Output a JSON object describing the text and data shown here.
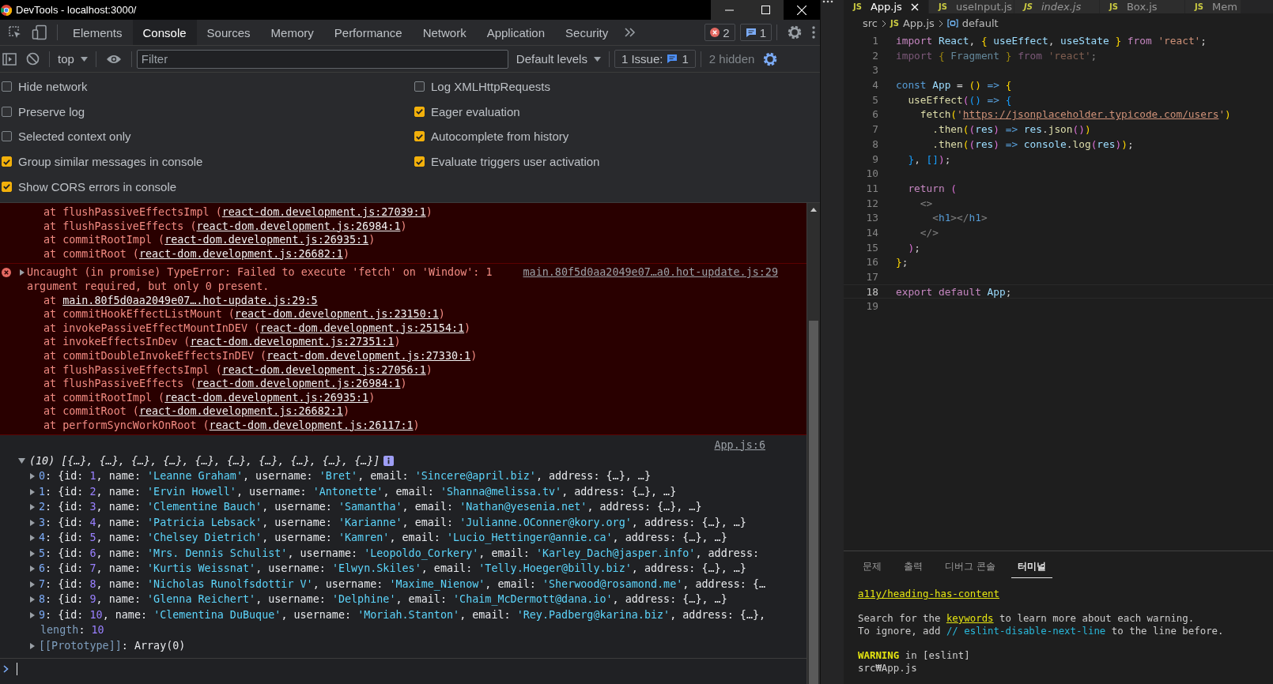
{
  "window": {
    "title": "DevTools - localhost:3000/"
  },
  "tabs": [
    {
      "label": "Elements",
      "selected": false
    },
    {
      "label": "Console",
      "selected": true
    },
    {
      "label": "Sources",
      "selected": false
    },
    {
      "label": "Memory",
      "selected": false
    },
    {
      "label": "Performance",
      "selected": false
    },
    {
      "label": "Network",
      "selected": false
    },
    {
      "label": "Application",
      "selected": false
    },
    {
      "label": "Security",
      "selected": false
    }
  ],
  "badges": {
    "errors": "2",
    "messages": "1"
  },
  "toolbar": {
    "context": "top",
    "filter_placeholder": "Filter",
    "levels": "Default levels",
    "issues_label": "1 Issue:",
    "issues_count": "1",
    "hidden": "2 hidden"
  },
  "settings": [
    {
      "label": "Hide network",
      "checked": false
    },
    {
      "label": "Preserve log",
      "checked": false
    },
    {
      "label": "Selected context only",
      "checked": false
    },
    {
      "label": "Group similar messages in console",
      "checked": true
    },
    {
      "label": "Show CORS errors in console",
      "checked": true
    },
    {
      "label": "Log XMLHttpRequests",
      "checked": false
    },
    {
      "label": "Eager evaluation",
      "checked": true
    },
    {
      "label": "Autocomplete from history",
      "checked": true
    },
    {
      "label": "Evaluate triggers user activation",
      "checked": true
    }
  ],
  "messages": [
    {
      "kind": "error",
      "frames": [
        {
          "fn": "at flushPassiveEffectsImpl (",
          "link": "react-dom.development.js:27039:1",
          "after": ")"
        },
        {
          "fn": "at flushPassiveEffects (",
          "link": "react-dom.development.js:26984:1",
          "after": ")"
        },
        {
          "fn": "at commitRootImpl (",
          "link": "react-dom.development.js:26935:1",
          "after": ")"
        },
        {
          "fn": "at commitRoot (",
          "link": "react-dom.development.js:26682:1",
          "after": ")"
        }
      ]
    },
    {
      "kind": "error",
      "text": "Uncaught (in promise) TypeError: Failed to execute 'fetch' on 'Window': 1 argument required, but only 0 present.",
      "source": "main.80f5d0aa2049e07…a0.hot-update.js:29",
      "frames": [
        {
          "fn": "at",
          "link": "main.80f5d0aa2049e07….hot-update.js:29:5"
        },
        {
          "fn": "at commitHookEffectListMount (",
          "link": "react-dom.development.js:23150:1",
          "after": ")"
        },
        {
          "fn": "at invokePassiveEffectMountInDEV (",
          "link": "react-dom.development.js:25154:1",
          "after": ")"
        },
        {
          "fn": "at invokeEffectsInDev (",
          "link": "react-dom.development.js:27351:1",
          "after": ")"
        },
        {
          "fn": "at commitDoubleInvokeEffectsInDEV (",
          "link": "react-dom.development.js:27330:1",
          "after": ")"
        },
        {
          "fn": "at flushPassiveEffectsImpl (",
          "link": "react-dom.development.js:27056:1",
          "after": ")"
        },
        {
          "fn": "at flushPassiveEffects (",
          "link": "react-dom.development.js:26984:1",
          "after": ")"
        },
        {
          "fn": "at commitRootImpl (",
          "link": "react-dom.development.js:26935:1",
          "after": ")"
        },
        {
          "fn": "at commitRoot (",
          "link": "react-dom.development.js:26682:1",
          "after": ")"
        },
        {
          "fn": "at performSyncWorkOnRoot (",
          "link": "react-dom.development.js:26117:1",
          "after": ")"
        }
      ]
    },
    {
      "kind": "log",
      "source": "App.js:6",
      "summary": "(10) [{…}, {…}, {…}, {…}, {…}, {…}, {…}, {…}, {…}, {…}]",
      "expanded": true,
      "rows": [
        [
          {
            "text": "0",
            "kind": "idx"
          },
          {
            "text": ": {id: ",
            "kind": "p"
          },
          {
            "text": "1",
            "kind": "num"
          },
          {
            "text": ", name: ",
            "kind": "p"
          },
          {
            "text": "'Leanne Graham'",
            "kind": "str"
          },
          {
            "text": ", username: ",
            "kind": "p"
          },
          {
            "text": "'Bret'",
            "kind": "str"
          },
          {
            "text": ", email: ",
            "kind": "p"
          },
          {
            "text": "'Sincere@april.biz'",
            "kind": "str"
          },
          {
            "text": ", address: {…}, …}",
            "kind": "p"
          }
        ],
        [
          {
            "text": "1",
            "kind": "idx"
          },
          {
            "text": ": {id: ",
            "kind": "p"
          },
          {
            "text": "2",
            "kind": "num"
          },
          {
            "text": ", name: ",
            "kind": "p"
          },
          {
            "text": "'Ervin Howell'",
            "kind": "str"
          },
          {
            "text": ", username: ",
            "kind": "p"
          },
          {
            "text": "'Antonette'",
            "kind": "str"
          },
          {
            "text": ", email: ",
            "kind": "p"
          },
          {
            "text": "'Shanna@melissa.tv'",
            "kind": "str"
          },
          {
            "text": ", address: {…}, …}",
            "kind": "p"
          }
        ],
        [
          {
            "text": "2",
            "kind": "idx"
          },
          {
            "text": ": {id: ",
            "kind": "p"
          },
          {
            "text": "3",
            "kind": "num"
          },
          {
            "text": ", name: ",
            "kind": "p"
          },
          {
            "text": "'Clementine Bauch'",
            "kind": "str"
          },
          {
            "text": ", username: ",
            "kind": "p"
          },
          {
            "text": "'Samantha'",
            "kind": "str"
          },
          {
            "text": ", email: ",
            "kind": "p"
          },
          {
            "text": "'Nathan@yesenia.net'",
            "kind": "str"
          },
          {
            "text": ", address: {…}, …}",
            "kind": "p"
          }
        ],
        [
          {
            "text": "3",
            "kind": "idx"
          },
          {
            "text": ": {id: ",
            "kind": "p"
          },
          {
            "text": "4",
            "kind": "num"
          },
          {
            "text": ", name: ",
            "kind": "p"
          },
          {
            "text": "'Patricia Lebsack'",
            "kind": "str"
          },
          {
            "text": ", username: ",
            "kind": "p"
          },
          {
            "text": "'Karianne'",
            "kind": "str"
          },
          {
            "text": ", email: ",
            "kind": "p"
          },
          {
            "text": "'Julianne.OConner@kory.org'",
            "kind": "str"
          },
          {
            "text": ", address: {…}, …}",
            "kind": "p"
          }
        ],
        [
          {
            "text": "4",
            "kind": "idx"
          },
          {
            "text": ": {id: ",
            "kind": "p"
          },
          {
            "text": "5",
            "kind": "num"
          },
          {
            "text": ", name: ",
            "kind": "p"
          },
          {
            "text": "'Chelsey Dietrich'",
            "kind": "str"
          },
          {
            "text": ", username: ",
            "kind": "p"
          },
          {
            "text": "'Kamren'",
            "kind": "str"
          },
          {
            "text": ", email: ",
            "kind": "p"
          },
          {
            "text": "'Lucio_Hettinger@annie.ca'",
            "kind": "str"
          },
          {
            "text": ", address: {…}, …}",
            "kind": "p"
          }
        ],
        [
          {
            "text": "5",
            "kind": "idx"
          },
          {
            "text": ": {id: ",
            "kind": "p"
          },
          {
            "text": "6",
            "kind": "num"
          },
          {
            "text": ", name: ",
            "kind": "p"
          },
          {
            "text": "'Mrs. Dennis Schulist'",
            "kind": "str"
          },
          {
            "text": ", username: ",
            "kind": "p"
          },
          {
            "text": "'Leopoldo_Corkery'",
            "kind": "str"
          },
          {
            "text": ", email: ",
            "kind": "p"
          },
          {
            "text": "'Karley_Dach@jasper.info'",
            "kind": "str"
          },
          {
            "text": ", address:",
            "kind": "p"
          }
        ],
        [
          {
            "text": "6",
            "kind": "idx"
          },
          {
            "text": ": {id: ",
            "kind": "p"
          },
          {
            "text": "7",
            "kind": "num"
          },
          {
            "text": ", name: ",
            "kind": "p"
          },
          {
            "text": "'Kurtis Weissnat'",
            "kind": "str"
          },
          {
            "text": ", username: ",
            "kind": "p"
          },
          {
            "text": "'Elwyn.Skiles'",
            "kind": "str"
          },
          {
            "text": ", email: ",
            "kind": "p"
          },
          {
            "text": "'Telly.Hoeger@billy.biz'",
            "kind": "str"
          },
          {
            "text": ", address: {…}, …}",
            "kind": "p"
          }
        ],
        [
          {
            "text": "7",
            "kind": "idx"
          },
          {
            "text": ": {id: ",
            "kind": "p"
          },
          {
            "text": "8",
            "kind": "num"
          },
          {
            "text": ", name: ",
            "kind": "p"
          },
          {
            "text": "'Nicholas Runolfsdottir V'",
            "kind": "str"
          },
          {
            "text": ", username: ",
            "kind": "p"
          },
          {
            "text": "'Maxime_Nienow'",
            "kind": "str"
          },
          {
            "text": ", email: ",
            "kind": "p"
          },
          {
            "text": "'Sherwood@rosamond.me'",
            "kind": "str"
          },
          {
            "text": ", address: {…",
            "kind": "p"
          }
        ],
        [
          {
            "text": "8",
            "kind": "idx"
          },
          {
            "text": ": {id: ",
            "kind": "p"
          },
          {
            "text": "9",
            "kind": "num"
          },
          {
            "text": ", name: ",
            "kind": "p"
          },
          {
            "text": "'Glenna Reichert'",
            "kind": "str"
          },
          {
            "text": ", username: ",
            "kind": "p"
          },
          {
            "text": "'Delphine'",
            "kind": "str"
          },
          {
            "text": ", email: ",
            "kind": "p"
          },
          {
            "text": "'Chaim_McDermott@dana.io'",
            "kind": "str"
          },
          {
            "text": ", address: {…}, …}",
            "kind": "p"
          }
        ],
        [
          {
            "text": "9",
            "kind": "idx"
          },
          {
            "text": ": {id: ",
            "kind": "p"
          },
          {
            "text": "10",
            "kind": "num"
          },
          {
            "text": ", name: ",
            "kind": "p"
          },
          {
            "text": "'Clementina DuBuque'",
            "kind": "str"
          },
          {
            "text": ", username: ",
            "kind": "p"
          },
          {
            "text": "'Moriah.Stanton'",
            "kind": "str"
          },
          {
            "text": ", email: ",
            "kind": "p"
          },
          {
            "text": "'Rey.Padberg@karina.biz'",
            "kind": "str"
          },
          {
            "text": ", address: {…},",
            "kind": "p"
          }
        ]
      ],
      "length": [
        {
          "text": "length",
          "kind": "meta"
        },
        {
          "text": ": ",
          "kind": "p"
        },
        {
          "text": "10",
          "kind": "num"
        }
      ],
      "prototype": [
        {
          "text": "[[Prototype]]",
          "kind": "meta"
        },
        {
          "text": ": Array(0)",
          "kind": "p"
        }
      ]
    }
  ],
  "editor": {
    "tabs": [
      {
        "icon": "JS",
        "label": "App.js",
        "selected": true
      },
      {
        "icon": "JS",
        "label": "useInput.js",
        "selected": false
      },
      {
        "icon": "JS",
        "label": "index.js",
        "selected": false
      },
      {
        "icon": "JS",
        "label": "Box.js",
        "selected": false
      },
      {
        "icon": "JS",
        "label": "Mem",
        "selected": false
      }
    ],
    "breadcrumb": {
      "folder": "src",
      "file_icon": "JS",
      "file": "App.js",
      "symbol": "default"
    },
    "lines": [
      {
        "n": "1",
        "tokens": [
          {
            "text": "import ",
            "kind": "kw"
          },
          {
            "text": "React",
            "kind": "var"
          },
          {
            "text": ", ",
            "kind": "p"
          },
          {
            "text": "{ ",
            "kind": "b1"
          },
          {
            "text": "useEffect",
            "kind": "var"
          },
          {
            "text": ", ",
            "kind": "p"
          },
          {
            "text": "useState",
            "kind": "var"
          },
          {
            "text": " }",
            "kind": "b1"
          },
          {
            "text": " from ",
            "kind": "kw"
          },
          {
            "text": "'react'",
            "kind": "str"
          },
          {
            "text": ";",
            "kind": "p"
          }
        ]
      },
      {
        "n": "2",
        "dim": true,
        "tokens": [
          {
            "text": "import ",
            "kind": "kw"
          },
          {
            "text": "{ ",
            "kind": "b1"
          },
          {
            "text": "Fragment",
            "kind": "var"
          },
          {
            "text": " }",
            "kind": "b1"
          },
          {
            "text": " from ",
            "kind": "kw"
          },
          {
            "text": "'react'",
            "kind": "str"
          },
          {
            "text": ";",
            "kind": "p"
          }
        ]
      },
      {
        "n": "3"
      },
      {
        "n": "4",
        "tokens": [
          {
            "text": "const ",
            "kind": "decl"
          },
          {
            "text": "App",
            "kind": "var"
          },
          {
            "text": " = ",
            "kind": "p"
          },
          {
            "text": "()",
            "kind": "b1"
          },
          {
            "text": " => ",
            "kind": "decl"
          },
          {
            "text": "{",
            "kind": "b1"
          }
        ]
      },
      {
        "n": "5",
        "tokens": [
          {
            "text": "  useEffect",
            "kind": "fn"
          },
          {
            "text": "(",
            "kind": "b2"
          },
          {
            "text": "()",
            "kind": "b3"
          },
          {
            "text": " => ",
            "kind": "decl"
          },
          {
            "text": "{",
            "kind": "b3"
          }
        ]
      },
      {
        "n": "6",
        "tokens": [
          {
            "text": "    fetch",
            "kind": "fn"
          },
          {
            "text": "(",
            "kind": "b1"
          },
          {
            "text": "'",
            "kind": "str"
          },
          {
            "text": "https://jsonplaceholder.typicode.com/users",
            "kind": "url"
          },
          {
            "text": "'",
            "kind": "str"
          },
          {
            "text": ")",
            "kind": "b1"
          }
        ]
      },
      {
        "n": "7",
        "tokens": [
          {
            "text": "      .then",
            "kind": "fn"
          },
          {
            "text": "(",
            "kind": "b1"
          },
          {
            "text": "(",
            "kind": "b2"
          },
          {
            "text": "res",
            "kind": "var"
          },
          {
            "text": ")",
            "kind": "b2"
          },
          {
            "text": " => ",
            "kind": "decl"
          },
          {
            "text": "res",
            "kind": "var"
          },
          {
            "text": ".",
            "kind": "p"
          },
          {
            "text": "json",
            "kind": "fn"
          },
          {
            "text": "()",
            "kind": "b2"
          },
          {
            "text": ")",
            "kind": "b1"
          }
        ]
      },
      {
        "n": "8",
        "tokens": [
          {
            "text": "      .then",
            "kind": "fn"
          },
          {
            "text": "(",
            "kind": "b1"
          },
          {
            "text": "(",
            "kind": "b2"
          },
          {
            "text": "res",
            "kind": "var"
          },
          {
            "text": ")",
            "kind": "b2"
          },
          {
            "text": " => ",
            "kind": "decl"
          },
          {
            "text": "console",
            "kind": "var"
          },
          {
            "text": ".",
            "kind": "p"
          },
          {
            "text": "log",
            "kind": "fn"
          },
          {
            "text": "(",
            "kind": "b2"
          },
          {
            "text": "res",
            "kind": "var"
          },
          {
            "text": ")",
            "kind": "b2"
          },
          {
            "text": ")",
            "kind": "b1"
          },
          {
            "text": ";",
            "kind": "p"
          }
        ]
      },
      {
        "n": "9",
        "tokens": [
          {
            "text": "  }",
            "kind": "b3"
          },
          {
            "text": ", ",
            "kind": "p"
          },
          {
            "text": "[]",
            "kind": "b3"
          },
          {
            "text": ")",
            "kind": "b2"
          },
          {
            "text": ";",
            "kind": "p"
          }
        ]
      },
      {
        "n": "10"
      },
      {
        "n": "11",
        "tokens": [
          {
            "text": "  return ",
            "kind": "kw"
          },
          {
            "text": "(",
            "kind": "b2"
          }
        ]
      },
      {
        "n": "12",
        "tokens": [
          {
            "text": "    <>",
            "kind": "tag"
          }
        ]
      },
      {
        "n": "13",
        "tokens": [
          {
            "text": "      <",
            "kind": "tag"
          },
          {
            "text": "h1",
            "kind": "decl"
          },
          {
            "text": "></",
            "kind": "tag"
          },
          {
            "text": "h1",
            "kind": "decl"
          },
          {
            "text": ">",
            "kind": "tag"
          }
        ]
      },
      {
        "n": "14",
        "tokens": [
          {
            "text": "    </>",
            "kind": "tag"
          }
        ]
      },
      {
        "n": "15",
        "tokens": [
          {
            "text": "  )",
            "kind": "b2"
          },
          {
            "text": ";",
            "kind": "p"
          }
        ]
      },
      {
        "n": "16",
        "tokens": [
          {
            "text": "}",
            "kind": "b1"
          },
          {
            "text": ";",
            "kind": "p"
          }
        ]
      },
      {
        "n": "17"
      },
      {
        "n": "18",
        "current": true,
        "tokens": [
          {
            "text": "export ",
            "kind": "kw"
          },
          {
            "text": "default ",
            "kind": "kw"
          },
          {
            "text": "App",
            "kind": "var"
          },
          {
            "text": ";",
            "kind": "p"
          }
        ]
      },
      {
        "n": "19"
      }
    ]
  },
  "panel": {
    "tabs": [
      {
        "label": "문제",
        "selected": false
      },
      {
        "label": "출력",
        "selected": false
      },
      {
        "label": "디버그 콘솔",
        "selected": false
      },
      {
        "label": "터미널",
        "selected": true
      }
    ],
    "paragraphs": [
      [
        [
          {
            "text": "a11y/heading-has-content",
            "kind": "link"
          }
        ]
      ],
      [
        [
          {
            "text": "Search for the ",
            "kind": "p"
          },
          {
            "text": "keywords",
            "kind": "link"
          },
          {
            "text": " to learn more about each warning.",
            "kind": "p"
          }
        ],
        [
          {
            "text": "To ignore, add ",
            "kind": "p"
          },
          {
            "text": "// eslint-disable-next-line",
            "kind": "code"
          },
          {
            "text": " to the line before.",
            "kind": "p"
          }
        ]
      ],
      [
        [
          {
            "text": "WARNING",
            "kind": "warn"
          },
          {
            "text": " in [eslint]",
            "kind": "p"
          }
        ],
        [
          {
            "text": "src₩App.js",
            "kind": "p"
          }
        ]
      ]
    ]
  }
}
